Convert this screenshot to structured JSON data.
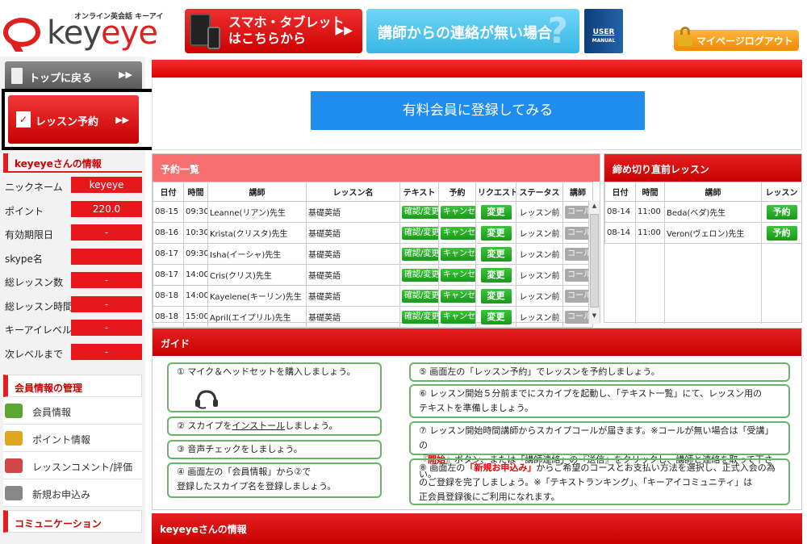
{
  "header": {
    "tagline": "オンライン英会話 キーアイ",
    "logo_text_a": "key",
    "logo_text_b": "eye",
    "smart_line1": "スマホ・タブレット",
    "smart_line2": "はこちらから",
    "contact_banner": "講師からの連絡が無い場合",
    "manual_line1": "USER",
    "manual_line2": "MANUAL",
    "logout": "マイページログアウト"
  },
  "sidebar": {
    "top_button": "トップに戻る",
    "reserve_button": "レッスン予約",
    "reserve_icon": "✓",
    "arrow": "▶▶",
    "user_section_title": "keyeyeさんの情報",
    "user_info": [
      {
        "label": "ニックネーム",
        "value": "keyeye"
      },
      {
        "label": "ポイント",
        "value": "220.0"
      },
      {
        "label": "有効期限日",
        "value": "-"
      },
      {
        "label": "skype名",
        "value": ""
      },
      {
        "label": "総レッスン数",
        "value": "-"
      },
      {
        "label": "総レッスン時間",
        "value": "-"
      },
      {
        "label": "キーアイレベル",
        "value": "-"
      },
      {
        "label": "次レベルまで",
        "value": "-"
      }
    ],
    "member_section_title": "会員情報の管理",
    "member_menu": [
      {
        "label": "会員情報",
        "icon": "id-card-icon",
        "color": "#5aa832"
      },
      {
        "label": "ポイント情報",
        "icon": "coins-icon",
        "color": "#e0a820"
      },
      {
        "label": "レッスンコメント/評価",
        "icon": "notepad-icon",
        "color": "#d04848"
      },
      {
        "label": "新規お申込み",
        "icon": "cart-icon",
        "color": "#888888"
      }
    ],
    "community_section_title": "コミュニケーション"
  },
  "main": {
    "register_button": "有料会員に登録してみる",
    "reservation": {
      "title": "予約一覧",
      "columns": [
        "日付",
        "時間",
        "講師",
        "レッスン名",
        "テキスト",
        "予約",
        "リクエスト",
        "ステータス",
        "講師"
      ],
      "rows": [
        {
          "date": "08-15",
          "time": "09:30",
          "teacher": "Leanne(リアン)先生",
          "lesson": "基礎英語"
        },
        {
          "date": "08-16",
          "time": "10:30",
          "teacher": "Krista(クリスタ)先生",
          "lesson": "基礎英語"
        },
        {
          "date": "08-17",
          "time": "09:30",
          "teacher": "Isha(イーシャ)先生",
          "lesson": "基礎英語"
        },
        {
          "date": "08-17",
          "time": "14:00",
          "teacher": "Cris(クリス)先生",
          "lesson": "基礎英語"
        },
        {
          "date": "08-18",
          "time": "14:00",
          "teacher": "Kayelene(キーリン)先生",
          "lesson": "基礎英語"
        },
        {
          "date": "08-18",
          "time": "15:00",
          "teacher": "April(エイプリル)先生",
          "lesson": "基礎英語"
        }
      ],
      "text_btn": "確認/変更",
      "cancel_btn": "キャンセル",
      "change_btn": "変更",
      "status": "レッスン前",
      "call_btn": "コール"
    },
    "deadline": {
      "title": "締め切り直前レッスン",
      "columns": [
        "日付",
        "時間",
        "講師",
        "レッスン"
      ],
      "rows": [
        {
          "date": "08-14",
          "time": "11:00",
          "teacher": "Beda(ベダ)先生"
        },
        {
          "date": "08-14",
          "time": "11:00",
          "teacher": "Veron(ヴェロン)先生"
        }
      ],
      "reserve_btn": "予約"
    },
    "guide": {
      "title": "ガイド",
      "s1": "① マイク＆ヘッドセットを購入しましょう。",
      "s2a": "② スカイプを",
      "s2b": "インストール",
      "s2c": "しましょう。",
      "s3": "③ 音声チェックをしましょう。",
      "s4a": "④ 画面左の「会員情報」から②で",
      "s4b": "登録したスカイプ名を登録しましょう。",
      "s5": "⑤ 画面左の「レッスン予約」でレッスンを予約しましょう。",
      "s6a": "⑥ レッスン開始５分前までにスカイプを起動し、「テキスト一覧」にて、レッスン用の",
      "s6b": "テキストを準備しましょう。",
      "s7a": "⑦ レッスン開始時間講師からスカイプコールが届きます。※コールが無い場合は「受講」の",
      "s7b": "『",
      "s7c": "開始",
      "s7d": "』ボタン、または「講師連絡」の『送信』をクリックし、講師と連絡を取って下さい。",
      "s8a": "⑧ 画面左の",
      "s8b": "「新規お申込み」",
      "s8c": "からご希望のコースとお支払い方法を選択し、正式入会の為",
      "s8d": "のご登録を完了しましょう。※「テキストランキング」、「キーアイコミュニティ」は",
      "s8e": "正会員登録後にご利用になれます。"
    },
    "info_title": "keyeyeさんの情報"
  }
}
